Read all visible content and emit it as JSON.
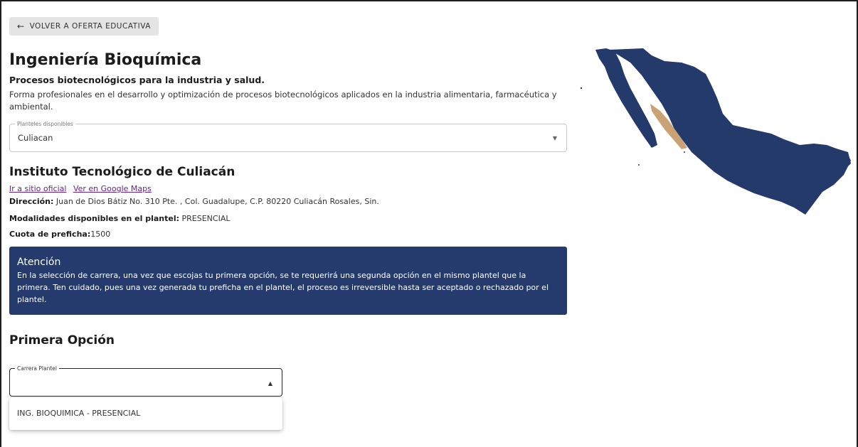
{
  "back_button": {
    "arrow": "←",
    "label": "VOLVER A OFERTA EDUCATIVA"
  },
  "program": {
    "title": "Ingeniería Bioquímica",
    "subtitle": "Procesos biotecnológicos para la industria y salud.",
    "description": "Forma profesionales en el desarrollo y optimización de procesos biotecnológicos aplicados en la industria alimentaria, farmacéutica y ambiental."
  },
  "plantel_select": {
    "legend": "Planteles disponibles",
    "value": "Culiacan",
    "caret": "▼"
  },
  "institute": {
    "name": "Instituto Tecnológico de Culiacán",
    "link_official": "Ir a sitio oficial",
    "link_maps": "Ver en Google Maps",
    "address_label": "Dirección:",
    "address_value": " Juan de Dios Bátiz No. 310 Pte. , Col. Guadalupe, C.P. 80220 Culiacán Rosales, Sin.",
    "modalities_label": "Modalidades disponibles en el plantel:",
    "modalities_value": " PRESENCIAL",
    "fee_label": "Cuota de preficha:",
    "fee_value": "1500"
  },
  "alert": {
    "title": "Atención",
    "body": "En la selección de carrera, una vez que escojas tu primera opción, se te requerirá una segunda opción en el mismo plantel que la primera. Ten cuidado, pues una vez generada tu preficha en el plantel, el proceso es irreversible hasta ser aceptado o rechazado por el plantel."
  },
  "first_option": {
    "title": "Primera Opción",
    "select_legend": "Carrera Plantel",
    "select_value": "",
    "caret": "▲",
    "options": [
      "ING. BIOQUIMICA - PRESENCIAL"
    ]
  },
  "map": {
    "base_color": "#233a6b",
    "highlight_color": "#c9a276",
    "highlighted_state": "Sinaloa"
  }
}
